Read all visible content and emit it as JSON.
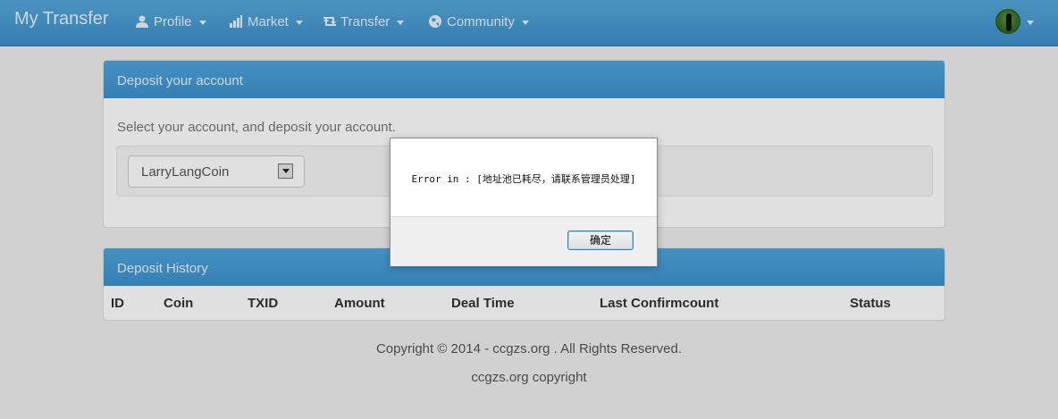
{
  "navbar": {
    "brand": "My Transfer",
    "items": [
      {
        "label": "Profile",
        "icon": "user-icon"
      },
      {
        "label": "Market",
        "icon": "bar-chart-icon"
      },
      {
        "label": "Transfer",
        "icon": "retweet-icon"
      },
      {
        "label": "Community",
        "icon": "globe-icon"
      }
    ],
    "avatar_icon": "avatar"
  },
  "deposit": {
    "title": "Deposit your account",
    "description": "Select your account, and deposit your account.",
    "selected_account": "LarryLangCoin"
  },
  "history": {
    "title": "Deposit History",
    "columns": [
      "ID",
      "Coin",
      "TXID",
      "Amount",
      "Deal Time",
      "Last Confirmcount",
      "Status"
    ]
  },
  "footer": {
    "copyright": "Copyright © 2014 - ccgzs.org . All Rights Reserved.",
    "site": "ccgzs.org copyright"
  },
  "dialog": {
    "message": "Error in : [地址池已耗尽，请联系管理员处理]",
    "ok_label": "确定"
  },
  "colors": {
    "navbar": "#4a9fd6",
    "panel_heading": "#4aa0d8"
  }
}
